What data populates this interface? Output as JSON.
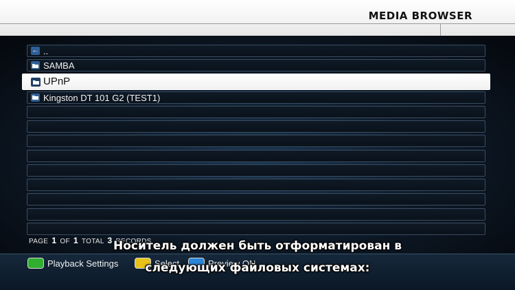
{
  "header": {
    "title": "MEDIA BROWSER"
  },
  "list": {
    "items": [
      {
        "label": "..",
        "icon": "back-arrow-icon",
        "selected": false
      },
      {
        "label": "SAMBA",
        "icon": "folder-icon",
        "selected": false
      },
      {
        "label": "UPnP",
        "icon": "folder-icon",
        "selected": true
      },
      {
        "label": "Kingston DT 101 G2 (TEST1)",
        "icon": "folder-icon",
        "selected": false
      },
      {
        "label": "",
        "icon": "",
        "selected": false
      },
      {
        "label": "",
        "icon": "",
        "selected": false
      },
      {
        "label": "",
        "icon": "",
        "selected": false
      },
      {
        "label": "",
        "icon": "",
        "selected": false
      },
      {
        "label": "",
        "icon": "",
        "selected": false
      },
      {
        "label": "",
        "icon": "",
        "selected": false
      },
      {
        "label": "",
        "icon": "",
        "selected": false
      },
      {
        "label": "",
        "icon": "",
        "selected": false
      },
      {
        "label": "",
        "icon": "",
        "selected": false
      }
    ]
  },
  "pager": {
    "page_word": "PAGE",
    "page": "1",
    "of_word": "OF",
    "pages": "1",
    "total_word": "TOTAL",
    "total": "3",
    "records_word": "RECORDS"
  },
  "footer": {
    "buttons": [
      {
        "label": "Playback Settings",
        "color": "#2fae2f"
      },
      {
        "label": "Select",
        "color": "#e8c21a"
      },
      {
        "label": "Preview ON",
        "color": "#2a86d8"
      }
    ]
  },
  "subtitle": {
    "line1": "Носитель должен быть отформатирован в",
    "line2": "следующих файловых системах:"
  }
}
